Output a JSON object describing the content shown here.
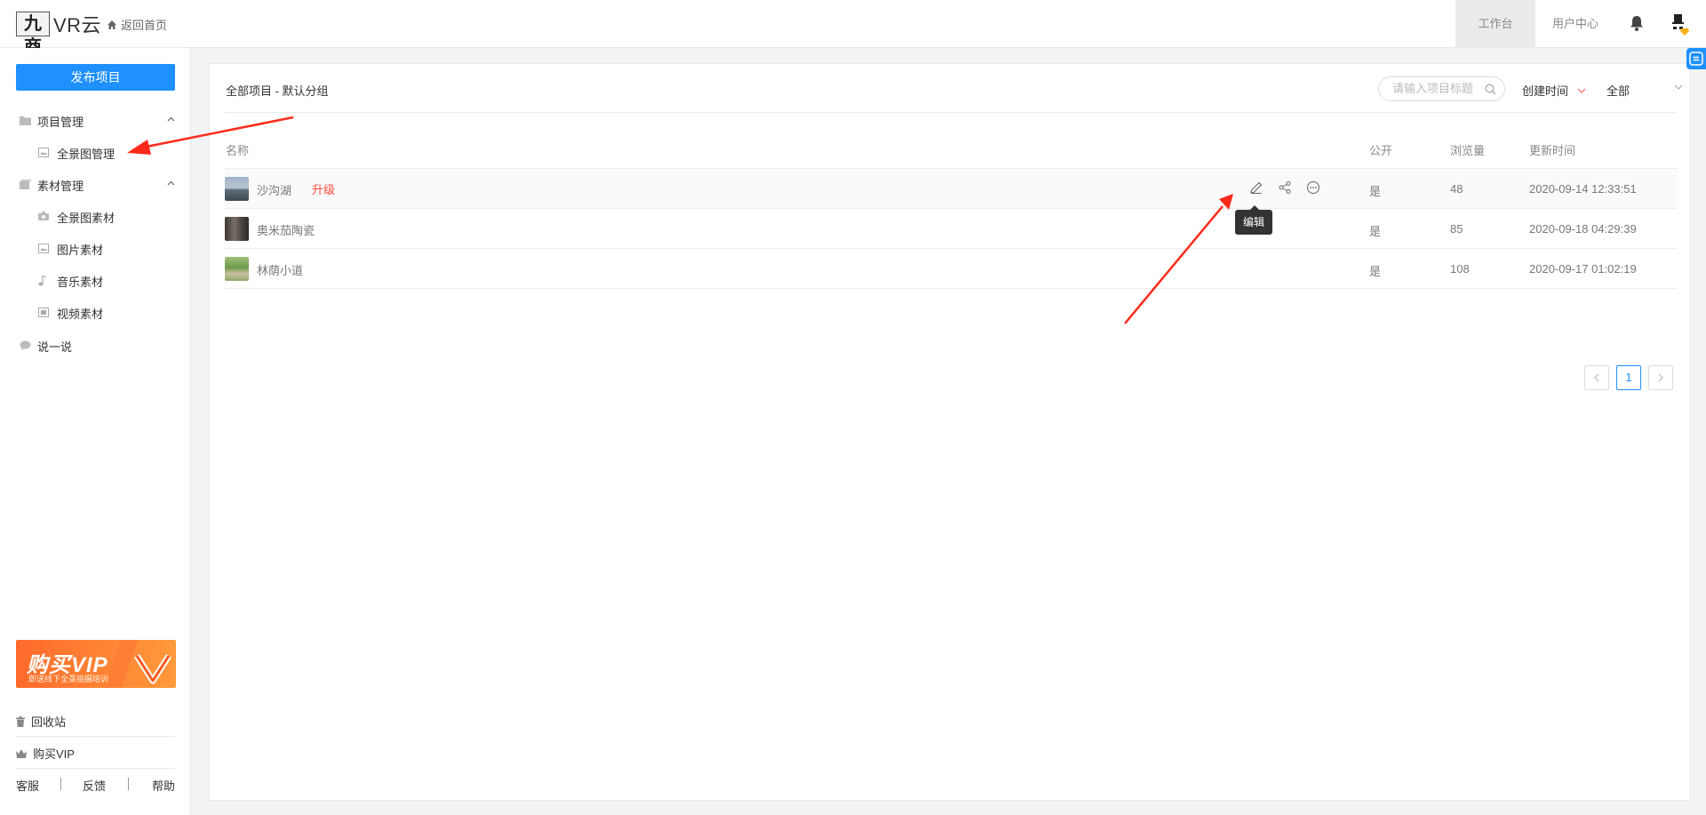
{
  "header": {
    "logo_mark": "九商",
    "logo_text": "VR云",
    "home_link": "返回首页",
    "nav": [
      "工作台",
      "用户中心"
    ]
  },
  "sidebar": {
    "publish_button": "发布项目",
    "groups": [
      {
        "label": "项目管理",
        "icon": "folder-icon",
        "items": [
          {
            "label": "全景图管理",
            "icon": "panorama-icon"
          }
        ]
      },
      {
        "label": "素材管理",
        "icon": "layers-icon",
        "items": [
          {
            "label": "全景图素材",
            "icon": "camera-icon"
          },
          {
            "label": "图片素材",
            "icon": "image-icon"
          },
          {
            "label": "音乐素材",
            "icon": "music-icon"
          },
          {
            "label": "视频素材",
            "icon": "video-icon"
          }
        ]
      }
    ],
    "say": "说一说",
    "vip_banner": {
      "title": "购买VIP",
      "subtitle": "即送线下全景拍摄培训"
    },
    "recycle": "回收站",
    "buy_vip": "购买VIP",
    "footer": [
      "客服",
      "反馈",
      "帮助"
    ]
  },
  "main": {
    "breadcrumb": "全部项目 - 默认分组",
    "search_placeholder": "请输入项目标题",
    "sort_label": "创建时间",
    "filter_label": "全部",
    "columns": {
      "name": "名称",
      "public": "公开",
      "views": "浏览量",
      "updated": "更新时间"
    },
    "rows": [
      {
        "name": "沙沟湖",
        "badge": "升级",
        "public": "是",
        "views": "48",
        "updated": "2020-09-14 12:33:51"
      },
      {
        "name": "奥米茄陶瓷",
        "badge": "",
        "public": "是",
        "views": "85",
        "updated": "2020-09-18 04:29:39"
      },
      {
        "name": "林荫小道",
        "badge": "",
        "public": "是",
        "views": "108",
        "updated": "2020-09-17 01:02:19"
      }
    ],
    "tooltip": "编辑",
    "pagination": {
      "current": "1"
    }
  },
  "colors": {
    "primary": "#1e90ff",
    "danger": "#ff4b3e",
    "annotation": "#ff2a1a"
  }
}
